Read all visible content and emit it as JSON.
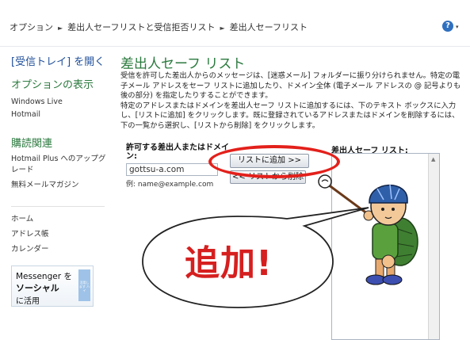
{
  "breadcrumb": {
    "items": [
      "オプション",
      "差出人セーフリストと受信拒否リスト",
      "差出人セーフリスト"
    ],
    "separator": "►"
  },
  "help": {
    "label": "?",
    "caret": "▾"
  },
  "sidebar": {
    "inbox_link": "[受信トレイ] を開く",
    "options_heading": "オプションの表示",
    "options_items": [
      "Windows Live",
      "Hotmail"
    ],
    "related_heading": "購読関連",
    "related_items": [
      "Hotmail Plus へのアップグレード",
      "無料メールマガジン"
    ],
    "nav_items": [
      "ホーム",
      "アドレス帳",
      "カレンダー"
    ],
    "messenger": {
      "line1": "Messenger を",
      "line2": "ソーシャル",
      "line3": "に活用",
      "thumb_text": "活用します ハイ"
    }
  },
  "main": {
    "title": "差出人セーフ リスト",
    "desc1": "受信を許可した差出人からのメッセージは、[迷惑メール] フォルダーに振り分けられません。特定の電子メール アドレスをセーフ リストに追加したり、ドメイン全体 (電子メール アドレスの @ 記号よりも後の部分) を指定したりすることができます。",
    "desc2": "特定のアドレスまたはドメインを差出人セーフ リストに追加するには、下のテキスト ボックスに入力し、[リストに追加] をクリックします。既に登録されているアドレスまたはドメインを削除するには、下の一覧から選択し、[リストから削除] をクリックします。",
    "allowed_label": "許可する差出人またはドメイン:",
    "input_value": "gottsu-a.com",
    "example": "例: name@example.com",
    "add_button": "リストに追加 >>",
    "remove_button": "<< リストから削除",
    "list_label": "差出人セーフ リスト:"
  },
  "overlay": {
    "bubble_text": "追加!",
    "colors": {
      "ring": "#e3201b",
      "bubble_text": "#d61f1f"
    }
  }
}
